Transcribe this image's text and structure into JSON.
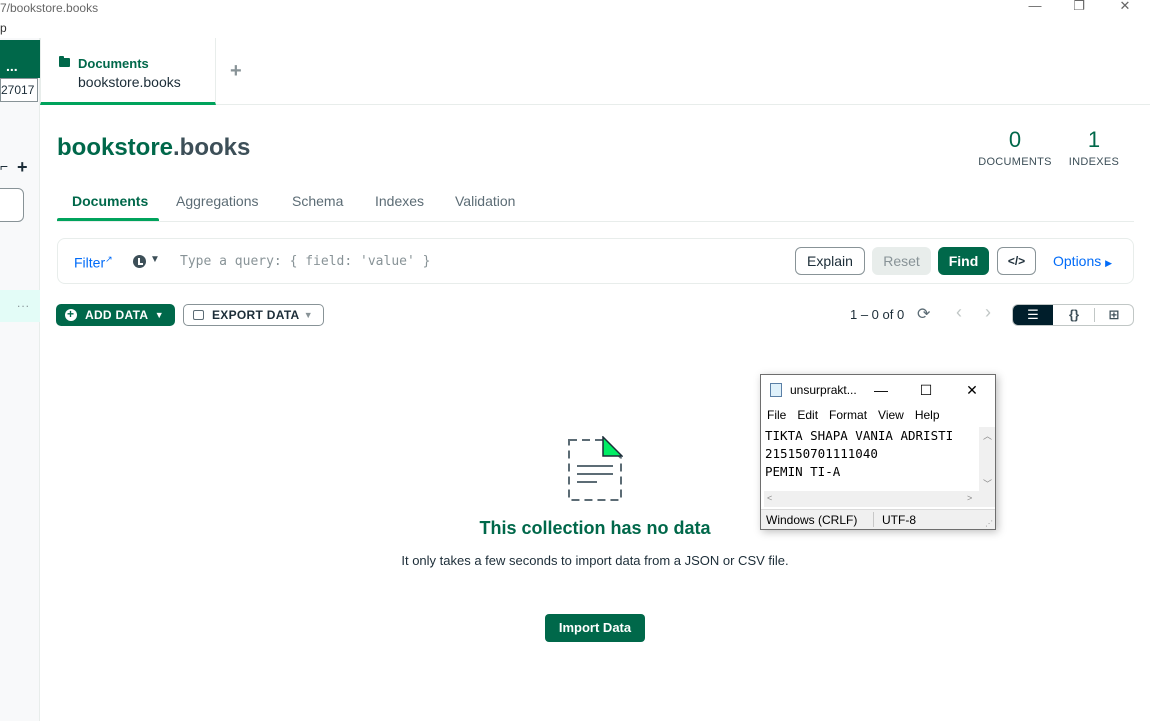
{
  "window": {
    "title": "7/bookstore.books",
    "menu_fragment": "p",
    "minimize": "—",
    "restore": "❐",
    "close": "✕"
  },
  "sidebar": {
    "connection_menu": "...",
    "port_fragment": "27017",
    "add_label": "+",
    "item_menu": "..."
  },
  "tabs": [
    {
      "name": "Documents",
      "subtitle": "bookstore.books"
    }
  ],
  "add_tab_label": "+",
  "header": {
    "database": "bookstore",
    "collection": ".books",
    "stats": [
      {
        "value": "0",
        "label": "DOCUMENTS"
      },
      {
        "value": "1",
        "label": "INDEXES"
      }
    ]
  },
  "subtabs": [
    "Documents",
    "Aggregations",
    "Schema",
    "Indexes",
    "Validation"
  ],
  "active_subtab": "Documents",
  "query": {
    "filter_label": "Filter",
    "placeholder": "Type a query: { field: 'value' }",
    "explain": "Explain",
    "reset": "Reset",
    "find": "Find",
    "code_icon": "</>",
    "options": "Options"
  },
  "toolbar": {
    "add_data": "ADD DATA",
    "export_data": "EXPORT DATA",
    "pagination": "1 – 0 of 0",
    "refresh_icon": "⟳",
    "prev_icon": "‹",
    "next_icon": "›",
    "views": [
      "list-view",
      "json-view",
      "table-view"
    ],
    "view_list_glyph": "☰",
    "view_json_glyph": "{}",
    "view_table_glyph": "⊞"
  },
  "empty_state": {
    "title": "This collection has no data",
    "description": "It only takes a few seconds to import data from a JSON or CSV file.",
    "import_button": "Import Data"
  },
  "notepad": {
    "title": "unsurprakt...",
    "menu": [
      "File",
      "Edit",
      "Format",
      "View",
      "Help"
    ],
    "content": "TIKTA SHAPA VANIA ADRISTI\n215150701111040\nPEMIN TI-A",
    "status_eol": "Windows (CRLF)",
    "status_encoding": "UTF-8",
    "minimize": "—",
    "maximize": "☐",
    "close": "✕"
  },
  "colors": {
    "brand_green": "#00684a",
    "accent_green": "#00a35c",
    "link_blue": "#016bf8"
  }
}
